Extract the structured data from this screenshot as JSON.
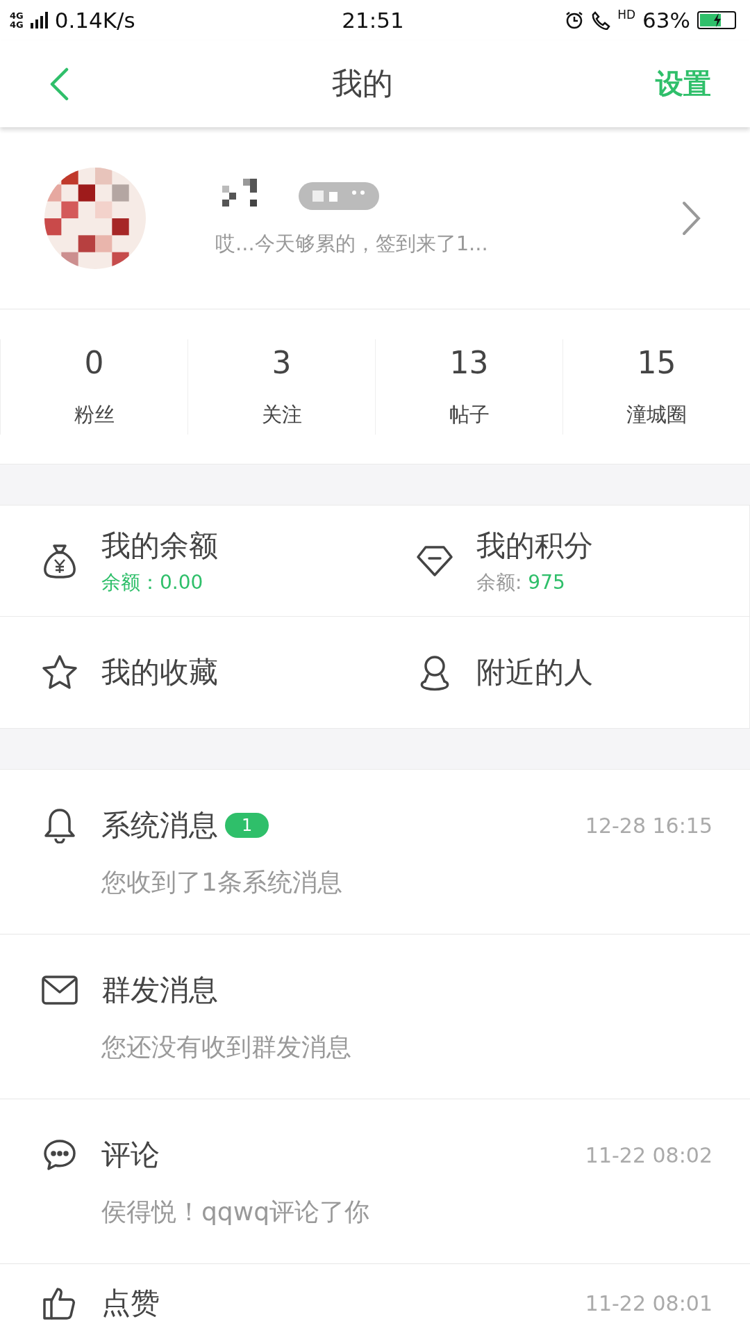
{
  "status_bar": {
    "network_labels": [
      "4G",
      "4G"
    ],
    "speed": "0.14K/s",
    "time": "21:51",
    "call_label": "HD",
    "battery": "63%",
    "charging": true
  },
  "nav": {
    "title": "我的",
    "action": "设置"
  },
  "profile": {
    "kind": "picture",
    "signature": "哎...今天够累的，签到来了1..."
  },
  "stats": [
    {
      "value": "0",
      "label": "粉丝"
    },
    {
      "value": "3",
      "label": "关注"
    },
    {
      "value": "13",
      "label": "帖子"
    },
    {
      "value": "15",
      "label": "潼城圈"
    }
  ],
  "grid": [
    {
      "kind": "moneybag",
      "title": "我的余额",
      "sub_label": "余额：",
      "sub_value": "0.00",
      "label_highlighted": true
    },
    {
      "kind": "diamond",
      "title": "我的积分",
      "sub_label": "余额: ",
      "sub_value": "975",
      "label_highlighted": false
    },
    {
      "kind": "star",
      "title": "我的收藏"
    },
    {
      "kind": "person",
      "title": "附近的人"
    }
  ],
  "messages": [
    {
      "kind": "bell",
      "title": "系统消息",
      "badge": "1",
      "time": "12-28 16:15",
      "preview": "您收到了1条系统消息"
    },
    {
      "kind": "mail",
      "title": "群发消息",
      "preview": "您还没有收到群发消息"
    },
    {
      "kind": "chat",
      "title": "评论",
      "time": "11-22 08:02",
      "preview": "侯得悦！qqwq评论了你"
    },
    {
      "kind": "thumb",
      "title": "点赞",
      "time": "11-22 08:01"
    }
  ]
}
